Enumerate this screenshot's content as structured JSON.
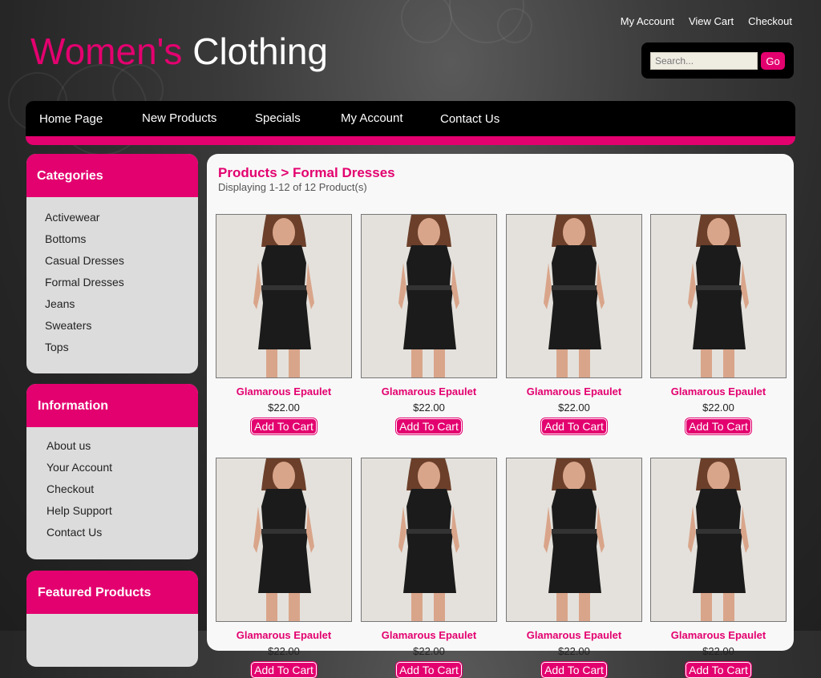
{
  "logo": {
    "part1": "Women's",
    "part2": "Clothing"
  },
  "top_links": [
    "My Account",
    "View Cart",
    "Checkout"
  ],
  "search": {
    "placeholder": "Search...",
    "button": "Go"
  },
  "nav": [
    "Home Page",
    "New Products",
    "Specials",
    "My Account",
    "Contact Us"
  ],
  "sidebar": {
    "categories": {
      "title": "Categories",
      "items": [
        "Activewear",
        "Bottoms",
        "Casual Dresses",
        "Formal Dresses",
        "Jeans",
        "Sweaters",
        "Tops"
      ]
    },
    "information": {
      "title": "Information",
      "items": [
        "About us",
        "Your Account",
        "Checkout",
        "Help Support",
        "Contact Us"
      ]
    },
    "featured": {
      "title": "Featured Products"
    }
  },
  "main": {
    "breadcrumb": "Products > Formal Dresses",
    "displaying": "Displaying 1-12 of 12 Product(s)",
    "products": [
      {
        "name": "Glamarous Epaulet",
        "price": "$22.00",
        "button": "Add To Cart"
      },
      {
        "name": "Glamarous Epaulet",
        "price": "$22.00",
        "button": "Add To Cart"
      },
      {
        "name": "Glamarous Epaulet",
        "price": "$22.00",
        "button": "Add To Cart"
      },
      {
        "name": "Glamarous Epaulet",
        "price": "$22.00",
        "button": "Add To Cart"
      },
      {
        "name": "Glamarous Epaulet",
        "price": "$22.00",
        "button": "Add To Cart"
      },
      {
        "name": "Glamarous Epaulet",
        "price": "$22.00",
        "button": "Add To Cart"
      },
      {
        "name": "Glamarous Epaulet",
        "price": "$22.00",
        "button": "Add To Cart"
      },
      {
        "name": "Glamarous Epaulet",
        "price": "$22.00",
        "button": "Add To Cart"
      }
    ]
  },
  "colors": {
    "brand_pink": "#e3006f",
    "nav_black": "#000000",
    "sidebar_gray": "#dcdcdc"
  }
}
